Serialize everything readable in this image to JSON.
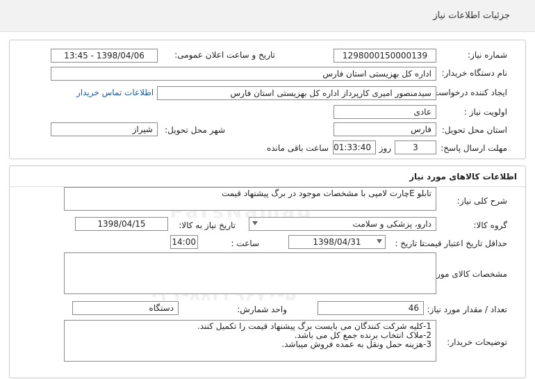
{
  "header": {
    "title": "جزئیات اطلاعات نیاز"
  },
  "section1": {
    "need_number_label": "شماره نیاز:",
    "need_number": "1298000150000139",
    "announce_label": "تاریخ و ساعت اعلان عمومی:",
    "announce_value": "1398/04/06 - 13:45",
    "buyer_label": "نام دستگاه خریدار:",
    "buyer_value": "اداره کل بهزیستی استان فارس",
    "creator_label": "ایجاد کننده درخواست:",
    "creator_value": "سیدمنصور امیری کارپرداز اداره کل بهزیستی استان فارس",
    "contact_link": "اطلاعات تماس خریدار",
    "priority_label": "اولویت نیاز :",
    "priority_value": "عادی",
    "province_label": "استان محل تحویل:",
    "province_value": "فارس",
    "city_label": "شهر محل تحویل:",
    "city_value": "شیراز",
    "deadline_label": "مهلت ارسال پاسخ:",
    "deadline_days": "3",
    "days_and_label": "روز و",
    "deadline_time": "01:33:40",
    "remaining_label": "ساعت باقی مانده"
  },
  "section2": {
    "title": "اطلاعات کالاهای مورد نیاز",
    "general_desc_label": "شرح کلی نیاز:",
    "general_desc_value": "تابلو Eچارت لامپی با مشخصات موجود در برگ پیشنهاد قیمت",
    "group_label": "گروه کالا:",
    "group_value": "دارو، پزشکی و سلامت",
    "need_date_label": "تاریخ نیاز به کالا:",
    "need_date_value": "1398/04/15",
    "min_validity_label": "حداقل تاریخ اعتبار قیمت:",
    "until_date_label": "تا تاریخ :",
    "until_date_value": "1398/04/31",
    "time_label": "ساعت :",
    "time_value": "14:00",
    "specs_label": "مشخصات کالای مورد نیاز:",
    "specs_value": "",
    "qty_label": "تعداد / مقدار مورد نیاز:",
    "qty_value": "46",
    "unit_label": "واحد شمارش:",
    "unit_value": "دستگاه",
    "buyer_notes_label": "توضیحات خریدار:",
    "buyer_notes": [
      "1-کلیه شرکت کنندگان می بایست برگ پیشنهاد قیمت را تکمیل کنند.",
      "2-ملاک انتخاب برنده جمع کل می باشد.",
      "3-هزینه حمل ونقل به عمده فروش میباشد."
    ]
  },
  "watermark": {
    "brand": "ParsNamad",
    "tagline": "پایگاه اطلاع رسانی مناقصه ومزایده",
    "phone": "۰۲۱-۸۸۳۴۹۶۷۰-۵"
  }
}
